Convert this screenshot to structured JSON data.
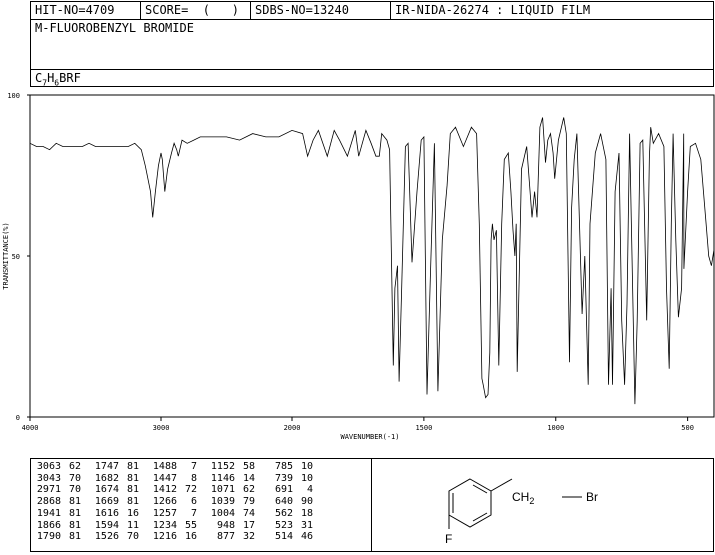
{
  "header": {
    "hit_no": "HIT-NO=4709",
    "score": "SCORE=  (   )",
    "sdbs_no": "SDBS-NO=13240",
    "ir_no": "IR-NIDA-26274 : LIQUID FILM",
    "compound_name": "M-FLUOROBENZYL BROMIDE",
    "formula_parts": [
      "C",
      "7",
      "H",
      "6",
      "BRF"
    ]
  },
  "chart_data": {
    "type": "line",
    "xlabel": "WAVENUMBER(-1)",
    "ylabel": "TRANSMITTANCE(%)",
    "xlim": [
      4000,
      400
    ],
    "ylim": [
      0,
      100
    ],
    "x_ticks": [
      "4000",
      "3000",
      "2000",
      "1500",
      "1000",
      "500"
    ],
    "y_ticks": [
      "100",
      "50",
      "0"
    ],
    "grid": false,
    "series": [
      {
        "x": [
          4000,
          3950,
          3900,
          3850,
          3800,
          3750,
          3700,
          3650,
          3600,
          3550,
          3500,
          3450,
          3400,
          3350,
          3300,
          3250,
          3200,
          3150,
          3120,
          3100,
          3080,
          3063,
          3043,
          3020,
          3000,
          2990,
          2971,
          2950,
          2920,
          2900,
          2880,
          2868,
          2840,
          2800,
          2750,
          2700,
          2600,
          2500,
          2400,
          2300,
          2200,
          2100,
          2000,
          1960,
          1941,
          1920,
          1900,
          1866,
          1840,
          1820,
          1790,
          1760,
          1747,
          1720,
          1700,
          1682,
          1674,
          1669,
          1660,
          1640,
          1630,
          1616,
          1610,
          1600,
          1594,
          1585,
          1570,
          1560,
          1545,
          1526,
          1510,
          1500,
          1488,
          1475,
          1460,
          1447,
          1430,
          1412,
          1400,
          1380,
          1350,
          1320,
          1300,
          1290,
          1280,
          1275,
          1266,
          1257,
          1250,
          1245,
          1240,
          1234,
          1225,
          1216,
          1205,
          1195,
          1180,
          1170,
          1162,
          1155,
          1150,
          1146,
          1130,
          1110,
          1090,
          1080,
          1071,
          1060,
          1050,
          1039,
          1030,
          1020,
          1010,
          1004,
          990,
          970,
          960,
          948,
          940,
          930,
          920,
          900,
          890,
          877,
          870,
          850,
          830,
          810,
          800,
          790,
          785,
          775,
          760,
          750,
          739,
          730,
          720,
          700,
          691,
          680,
          670,
          655,
          645,
          640,
          630,
          610,
          590,
          580,
          570,
          562,
          555,
          545,
          535,
          523,
          515,
          514,
          500,
          490,
          470,
          450,
          430,
          420,
          410,
          400
        ],
        "y": [
          85,
          84,
          84,
          83,
          85,
          84,
          84,
          84,
          84,
          85,
          84,
          84,
          84,
          84,
          84,
          84,
          85,
          83,
          78,
          74,
          70,
          62,
          70,
          78,
          82,
          80,
          70,
          77,
          82,
          85,
          83,
          81,
          86,
          85,
          86,
          87,
          87,
          87,
          86,
          88,
          87,
          87,
          89,
          88,
          81,
          86,
          89,
          81,
          89,
          86,
          81,
          89,
          81,
          89,
          85,
          81,
          81,
          81,
          88,
          86,
          83,
          16,
          40,
          47,
          11,
          38,
          84,
          85,
          48,
          70,
          86,
          87,
          7,
          45,
          85,
          8,
          55,
          72,
          88,
          90,
          84,
          90,
          88,
          60,
          12,
          10,
          6,
          7,
          20,
          55,
          60,
          55,
          58,
          16,
          60,
          80,
          82,
          70,
          58,
          50,
          60,
          14,
          77,
          84,
          62,
          70,
          62,
          90,
          93,
          79,
          86,
          88,
          82,
          74,
          86,
          93,
          88,
          17,
          65,
          80,
          88,
          32,
          50,
          10,
          60,
          82,
          88,
          80,
          10,
          40,
          10,
          70,
          82,
          30,
          10,
          35,
          88,
          4,
          30,
          85,
          86,
          30,
          81,
          90,
          85,
          88,
          84,
          40,
          15,
          60,
          88,
          55,
          31,
          40,
          88,
          46,
          70,
          84,
          85,
          80,
          60,
          50,
          47,
          52
        ]
      }
    ],
    "peak_table": [
      [
        "3063",
        "62",
        "1747",
        "81",
        "1488",
        "7",
        "1152",
        "58",
        "785",
        "10"
      ],
      [
        "3043",
        "70",
        "1682",
        "81",
        "1447",
        "8",
        "1146",
        "14",
        "739",
        "10"
      ],
      [
        "2971",
        "70",
        "1674",
        "81",
        "1412",
        "72",
        "1071",
        "62",
        "691",
        "4"
      ],
      [
        "2868",
        "81",
        "1669",
        "81",
        "1266",
        "6",
        "1039",
        "79",
        "640",
        "90"
      ],
      [
        "1941",
        "81",
        "1616",
        "16",
        "1257",
        "7",
        "1004",
        "74",
        "562",
        "18"
      ],
      [
        "1866",
        "81",
        "1594",
        "11",
        "1234",
        "55",
        "948",
        "17",
        "523",
        "31"
      ],
      [
        "1790",
        "81",
        "1526",
        "70",
        "1216",
        "16",
        "877",
        "32",
        "514",
        "46"
      ]
    ]
  },
  "structure": {
    "ch2_label": "CH",
    "ch2_sub": "2",
    "br_label": "Br",
    "f_label": "F"
  }
}
